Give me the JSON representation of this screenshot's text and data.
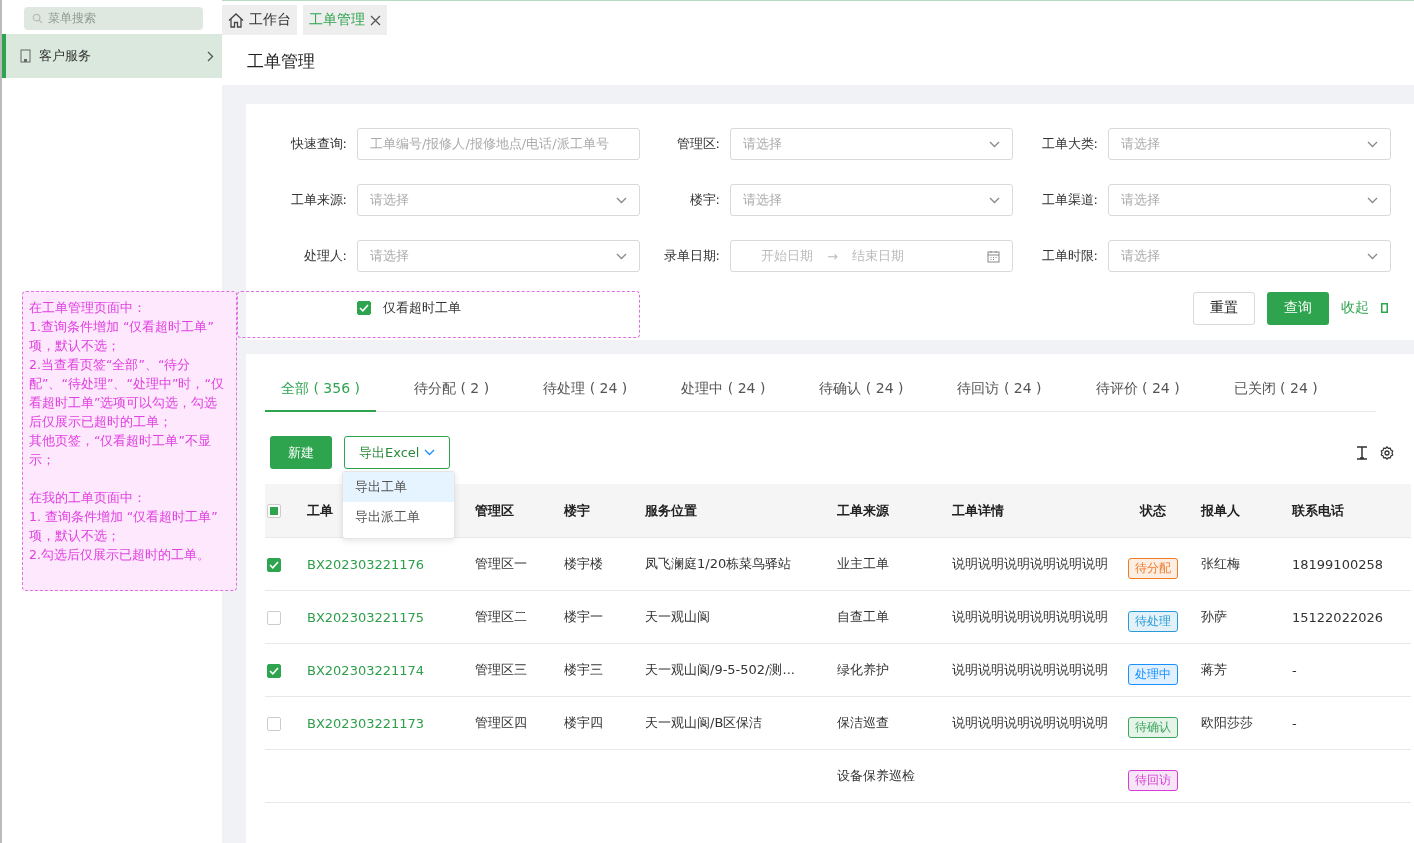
{
  "sidebar": {
    "search": {
      "placeholder": "菜单搜索"
    },
    "items": [
      {
        "label": "客户服务",
        "selected": true
      }
    ]
  },
  "tabs": [
    {
      "label": "工作台",
      "selected": false,
      "kind": "home"
    },
    {
      "label": "工单管理",
      "selected": true,
      "kind": "closable"
    }
  ],
  "page_title": "工单管理",
  "filters": [
    {
      "label": "快速查询:",
      "kind": "text",
      "placeholder": "工单编号/报修人/报修地点/电话/派工单号"
    },
    {
      "label": "管理区:",
      "kind": "select",
      "placeholder": "请选择"
    },
    {
      "label": "工单大类:",
      "kind": "select",
      "placeholder": "请选择"
    },
    {
      "label": "工单来源:",
      "kind": "select",
      "placeholder": "请选择"
    },
    {
      "label": "楼宇:",
      "kind": "select",
      "placeholder": "请选择"
    },
    {
      "label": "工单渠道:",
      "kind": "select",
      "placeholder": "请选择"
    },
    {
      "label": "处理人:",
      "kind": "select",
      "placeholder": "请选择"
    },
    {
      "label": "录单日期:",
      "kind": "date",
      "start_placeholder": "开始日期",
      "separator": "→",
      "end_placeholder": "结束日期"
    },
    {
      "label": "工单时限:",
      "kind": "select",
      "placeholder": "请选择"
    }
  ],
  "timeout_filter": {
    "label": "仅看超时工单",
    "checked": true
  },
  "filter_buttons": {
    "reset": "重置",
    "search": "查询",
    "collapse": "收起"
  },
  "status_tabs": [
    {
      "label": "全部 ( 356 )",
      "selected": true
    },
    {
      "label": "待分配 ( 2 )",
      "selected": false
    },
    {
      "label": "待处理 ( 24 )",
      "selected": false
    },
    {
      "label": "处理中 ( 24 )",
      "selected": false
    },
    {
      "label": "待确认 ( 24 )",
      "selected": false
    },
    {
      "label": "待回访 ( 24 )",
      "selected": false
    },
    {
      "label": "待评价 ( 24 )",
      "selected": false
    },
    {
      "label": "已关闭 ( 24 )",
      "selected": false
    }
  ],
  "actions": {
    "new": "新建",
    "export": "导出Excel",
    "export_menu": [
      {
        "label": "导出工单",
        "selected": true
      },
      {
        "label": "导出派工单",
        "selected": false
      }
    ]
  },
  "table": {
    "select_all": {
      "indeterminate": true
    },
    "columns": [
      "工单",
      "管理区",
      "楼宇",
      "服务位置",
      "工单来源",
      "工单详情",
      "状态",
      "报单人",
      "联系电话"
    ],
    "rows": [
      {
        "checked": true,
        "id": "BX202303221176",
        "area": "管理区一",
        "building": "楼宇楼",
        "location": "凤飞澜庭1/20栋菜鸟驿站",
        "source": "业主工单",
        "detail": "说明说明说明说明说明说明",
        "status": {
          "label": "待分配",
          "color": "#f07c2a"
        },
        "reporter": "张红梅",
        "phone": "18199100258"
      },
      {
        "checked": false,
        "id": "BX202303221175",
        "area": "管理区二",
        "building": "楼宇一",
        "location": "天一观山阆",
        "source": "自查工单",
        "detail": "说明说明说明说明说明说明",
        "status": {
          "label": "待处理",
          "color": "#2b9bd8"
        },
        "reporter": "孙萨",
        "phone": "15122022026"
      },
      {
        "checked": true,
        "id": "BX202303221174",
        "area": "管理区三",
        "building": "楼宇三",
        "location": "天一观山阆/9-5-502/测...",
        "source": "绿化养护",
        "detail": "说明说明说明说明说明说明",
        "status": {
          "label": "处理中",
          "color": "#1890ff"
        },
        "reporter": "蒋芳",
        "phone": "-"
      },
      {
        "checked": false,
        "id": "BX202303221173",
        "area": "管理区四",
        "building": "楼宇四",
        "location": "天一观山阆/B区保洁",
        "source": "保洁巡查",
        "detail": "说明说明说明说明说明说明",
        "status": {
          "label": "待确认",
          "color": "#3ba55c"
        },
        "reporter": "欧阳莎莎",
        "phone": "-"
      },
      {
        "source": "设备保养巡检",
        "status": {
          "label": "待回访",
          "color": "#d23fd2"
        }
      }
    ]
  },
  "notes": [
    [
      "在工单管理页面中：",
      "1.查询条件增加 “仅看超时工单” 项，默认不选；",
      "2.当查看页签“全部”、“待分配”、“待处理”、“处理中”时，“仅看超时工单”选项可以勾选，勾选后仅展示已超时的工单；",
      "其他页签，“仅看超时工单”不显示；"
    ],
    [
      "在我的工单页面中：",
      "1. 查询条件增加 “仅看超时工单” 项，默认不选；",
      "2.勾选后仅展示已超时的工单。"
    ]
  ]
}
